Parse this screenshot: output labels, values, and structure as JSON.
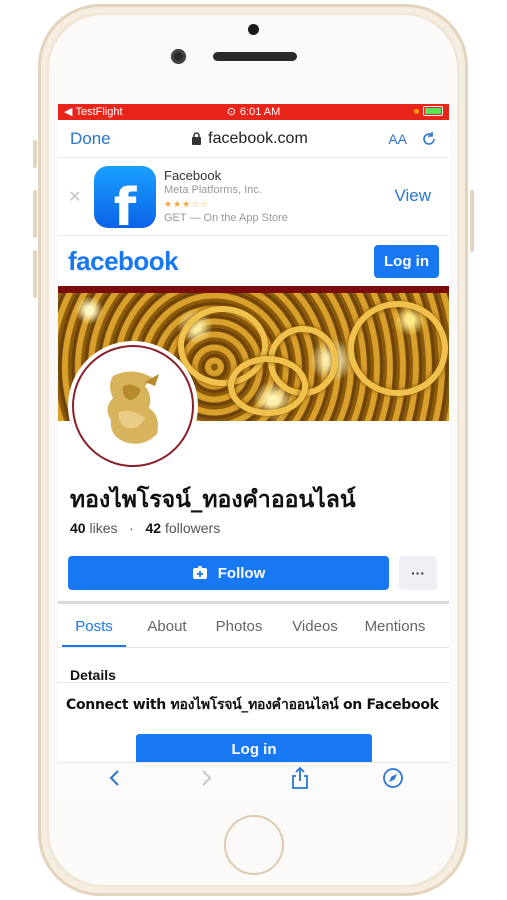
{
  "status_bar": {
    "back_app": "TestFlight",
    "time": "6:01 AM",
    "alarm_icon": "alarm-icon",
    "battery_icon": "battery-charging-icon"
  },
  "browser": {
    "done_label": "Done",
    "url": "facebook.com",
    "text_size_label": "AA",
    "reload_icon": "reload-icon"
  },
  "app_banner": {
    "app_name": "Facebook",
    "developer": "Meta Platforms, Inc.",
    "rating_stars": "★★★☆☆",
    "store_text": "GET — On the App Store",
    "view_label": "View",
    "icon_letter": "f"
  },
  "fb_header": {
    "logo": "facebook",
    "login_label": "Log in"
  },
  "page": {
    "name": "ทองไพโรจน์_ทองคำออนไลน์",
    "likes_count": "40",
    "likes_label": "likes",
    "followers_count": "42",
    "followers_label": "followers",
    "follow_label": "Follow",
    "more_label": "···"
  },
  "tabs": [
    "Posts",
    "About",
    "Photos",
    "Videos",
    "Mentions"
  ],
  "details_heading": "Details",
  "connect_text": "Connect with ทองไพโรจน์_ทองคำออนไลน์ on Facebook",
  "bottom_login_label": "Log in",
  "toolbar": {
    "back_icon": "back-arrow-icon",
    "forward_icon": "forward-arrow-icon",
    "share_icon": "share-icon",
    "compass_icon": "compass-icon"
  },
  "colors": {
    "facebook_blue": "#1877f2",
    "ios_link_blue": "#2a76d2",
    "status_red": "#e8241b",
    "phone_frame": "#efe6d8"
  }
}
